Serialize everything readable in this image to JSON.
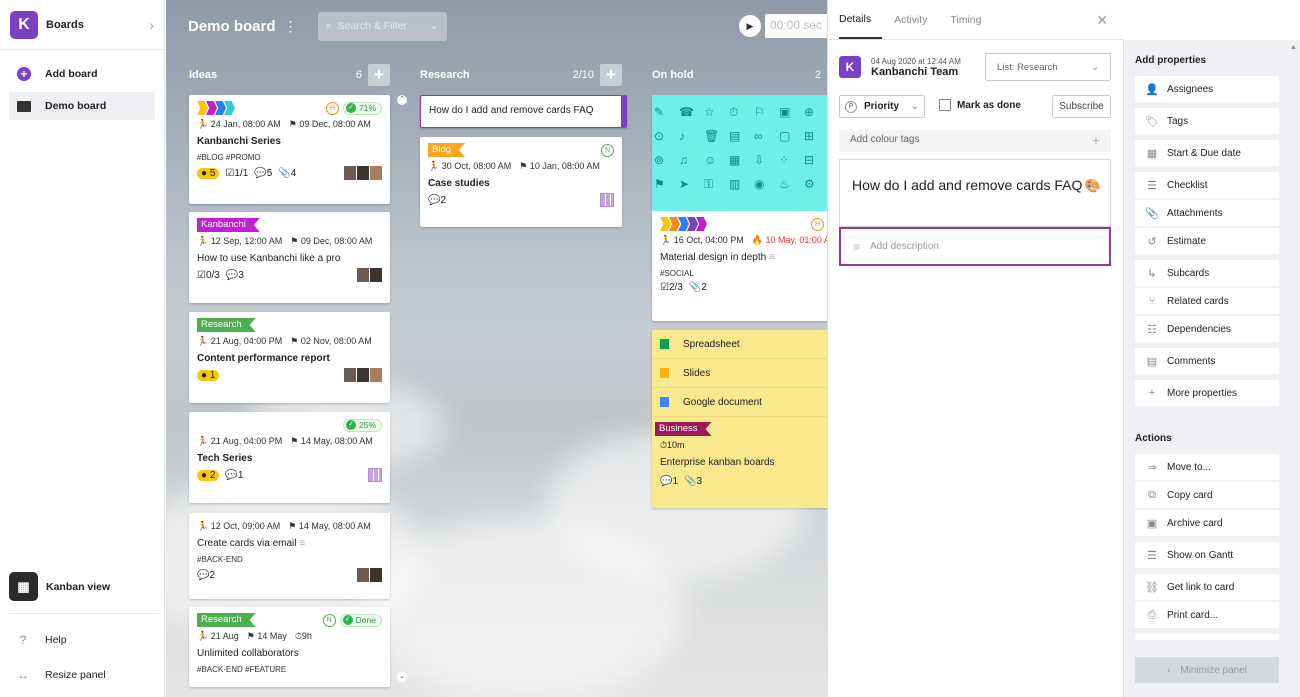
{
  "app": {
    "name": "Boards"
  },
  "nav": {
    "add_board": "Add board",
    "demo_board": "Demo board",
    "kanban_view": "Kanban view",
    "help": "Help",
    "resize_panel": "Resize panel"
  },
  "board": {
    "title": "Demo board",
    "search_placeholder": "Search & Filter",
    "timer": "00:00 sec"
  },
  "columns": [
    {
      "name": "Ideas",
      "count": "6"
    },
    {
      "name": "Research",
      "count": "2/10"
    },
    {
      "name": "On hold",
      "count": "2"
    }
  ],
  "ideas": {
    "c1": {
      "h": "H",
      "pct": "71%",
      "d1": "24 Jan, 08:00 AM",
      "d2": "09 Dec, 08:00 AM",
      "title": "Kanbanchi Series",
      "tags": "#BLOG  #PROMO",
      "b1": "5",
      "b2": "1/1",
      "b3": "5",
      "b4": "4"
    },
    "c2": {
      "ribbon": "Kanbanchi",
      "d1": "12 Sep, 12:00 AM",
      "d2": "09 Dec, 08:00 AM",
      "title": "How to use Kanbanchi like a pro",
      "b1": "0/3",
      "b2": "3"
    },
    "c3": {
      "ribbon": "Research",
      "d1": "21 Aug, 04:00 PM",
      "d2": "02 Nov, 08:00 AM",
      "title": "Content performance report",
      "b1": "1"
    },
    "c4": {
      "pct": "25%",
      "d1": "21 Aug, 04:00 PM",
      "d2": "14 May, 08:00 AM",
      "title": "Tech Series",
      "b1": "2",
      "b2": "1"
    },
    "c5": {
      "d1": "12 Oct, 09:00 AM",
      "d2": "14 May, 08:00 AM",
      "title": "Create cards via email",
      "tags": "#BACK-END",
      "b1": "2"
    },
    "c6": {
      "ribbon": "Research",
      "n": "N",
      "pct": "Done",
      "d1": "21 Aug",
      "d2": "14 May",
      "d3": "9h",
      "title": "Unlimited collaborators",
      "tags": "#BACK-END  #FEATURE"
    }
  },
  "research": {
    "c1": {
      "title": "How do I add and remove cards FAQ"
    },
    "c2": {
      "ribbon": "Blog",
      "n": "N",
      "d1": "30 Oct, 08:00 AM",
      "d2": "10 Jan, 08:00 AM",
      "title": "Case studies",
      "b1": "2"
    }
  },
  "onhold": {
    "c1": {
      "h": "H",
      "d1": "16 Oct, 04:00 PM",
      "d2": "10 May, 01:00 A",
      "title": "Material design in depth",
      "tags": "#SOCIAL",
      "b1": "2/3",
      "b2": "2"
    },
    "c2": {
      "f1": "Spreadsheet",
      "f2": "Slides",
      "f3": "Google document",
      "ribbon": "Business",
      "est": "10m",
      "title": "Enterprise kanban boards",
      "b1": "1",
      "b2": "3"
    }
  },
  "detail": {
    "tabs": [
      "Details",
      "Activity",
      "Timing"
    ],
    "date": "04 Aug 2020 at 12:44 AM",
    "team": "Kanbanchi Team",
    "list": "List: Research",
    "priority": "Priority",
    "mark_done": "Mark as done",
    "subscribe": "Subscribe",
    "colour_tags": "Add colour tags",
    "card_title": "How do I add and remove cards FAQ",
    "description_placeholder": "Add description"
  },
  "properties": {
    "heading": "Add properties",
    "items": [
      "Assignees",
      "Tags",
      "Start & Due date",
      "Checklist",
      "Attachments",
      "Estimate",
      "Subcards",
      "Related cards",
      "Dependencies",
      "Comments",
      "More properties"
    ]
  },
  "actions": {
    "heading": "Actions",
    "items": [
      "Move to...",
      "Copy card",
      "Archive card",
      "Show on Gantt",
      "Get link to card",
      "Print card..."
    ],
    "minimize": "Minimize panel"
  },
  "colors": {
    "brand": "#7b3fc4",
    "research": "#4caf50",
    "blog": "#f5a623",
    "kanbanchi": "#c21fd1",
    "business": "#a0175a",
    "teal": "#6ef0e9",
    "yellow": "#f8e88e",
    "focus": "#9a33a8"
  }
}
